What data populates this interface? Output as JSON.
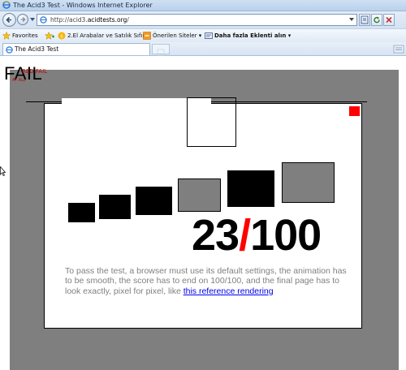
{
  "window": {
    "title": "The Acid3 Test - Windows Internet Explorer"
  },
  "address_bar": {
    "url_prefix": "http://acid3.",
    "url_domain": "acidtests.org",
    "url_suffix": "/"
  },
  "favorites_bar": {
    "favorites_label": "Favorites",
    "items": [
      {
        "label": "2.El Arabalar ve Satılık Sıfır..."
      },
      {
        "label": "Önerilen Siteler ▾"
      },
      {
        "label": "Daha fazla Eklenti alın ▾"
      }
    ]
  },
  "tabs": [
    {
      "label": "The Acid3 Test"
    }
  ],
  "acid": {
    "fail_text": "FAIL",
    "fail_overlay": "RED FAIL",
    "fail_sub": "AT ALL",
    "score_value": "23",
    "score_slash": "/",
    "score_total": "100",
    "description": "To pass the test, a browser must use its default settings, the animation has to be smooth, the score has to end on 100/100, and the final page has to look exactly, pixel for pixel, like ",
    "reference_link": "this reference rendering"
  },
  "colors": {
    "stage": "#7f7f7f",
    "accent_red": "#ff0000",
    "link": "#0000ee",
    "text_grey": "#808080"
  },
  "icons": [
    "ie-logo-icon",
    "back-arrow-icon",
    "forward-arrow-icon",
    "page-icon",
    "refresh-icon",
    "stop-icon",
    "favorites-star-icon",
    "add-favorite-icon",
    "suggested-sites-icon",
    "web-slice-icon",
    "tab-page-icon",
    "new-tab-icon",
    "cursor-icon"
  ]
}
